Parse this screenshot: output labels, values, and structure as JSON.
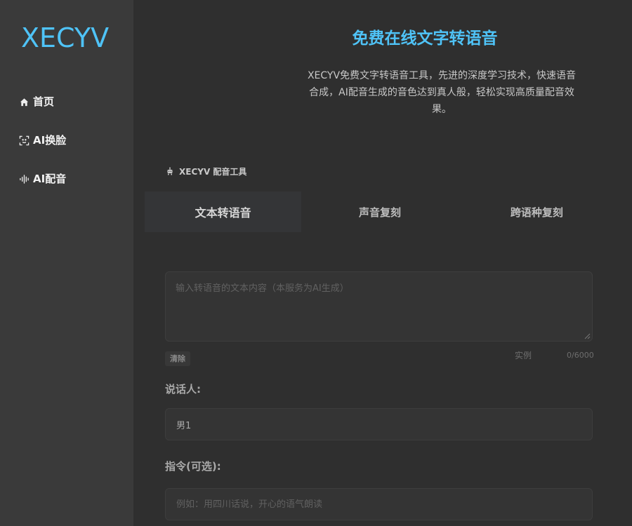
{
  "sidebar": {
    "logo": "XECYV",
    "items": [
      {
        "label": "首页",
        "icon": "home-icon"
      },
      {
        "label": "AI换脸",
        "icon": "face-scan-icon"
      },
      {
        "label": "AI配音",
        "icon": "audio-wave-icon"
      }
    ]
  },
  "main": {
    "title": "免费在线文字转语音",
    "description": "XECYV免费文字转语音工具，先进的深度学习技术，快速语音合成，AI配音生成的音色达到真人般，轻松实现高质量配音效果。",
    "tool_label": "XECYV 配音工具",
    "tool_icon": "robot-icon",
    "tabs": [
      {
        "label": "文本转语音",
        "active": true
      },
      {
        "label": "声音复刻",
        "active": false
      },
      {
        "label": "跨语种复刻",
        "active": false
      }
    ],
    "text_input": {
      "placeholder": "输入转语音的文本内容（本服务为AI生成）",
      "value": ""
    },
    "clear_label": "清除",
    "example_label": "实例",
    "char_count": "0/6000",
    "speaker_label": "说话人:",
    "speaker_value": "男1",
    "instruction_label": "指令(可选):",
    "instruction_input": {
      "placeholder": "例如：用四川话说，开心的语气朗读",
      "value": ""
    }
  },
  "colors": {
    "accent": "#4fc3f7",
    "sidebar_bg": "#3a3a3a",
    "main_bg": "#2f2f2f"
  }
}
